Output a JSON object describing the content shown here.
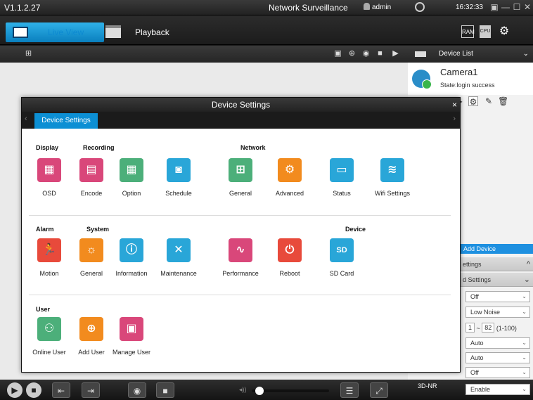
{
  "titlebar": {
    "version": "V1.1.2.27",
    "app_title": "Network Surveillance",
    "user": "admin",
    "time": "16:32:33",
    "globe_icon": "globe-icon",
    "window_buttons": [
      "▣",
      "—",
      "☐",
      "✕"
    ]
  },
  "toolbar": {
    "live_view": "Live View",
    "playback": "Playback",
    "ram_label": "RAM",
    "cpu_label": "CPU",
    "settings_icon": "gear-icon"
  },
  "video_bar": {
    "left_icon": "grid-icon",
    "icons": [
      "▣",
      "⊕",
      "◉",
      "■",
      "▶"
    ]
  },
  "right_panel": {
    "device_list": "Device List",
    "camera_name": "Camera1",
    "camera_state": "State:login success",
    "add_device": "Add Device",
    "settings_section": "ettings",
    "image_settings_section": "d Settings",
    "rows": [
      "Off",
      "Low Noise",
      "Auto",
      "Auto",
      "Off"
    ],
    "range_min": "1",
    "range_max": "82",
    "range_hint": "(1-100)"
  },
  "bottom_bar": {
    "nr_label": "3D-NR",
    "nr_value": "Enable",
    "volume_level": 0.05
  },
  "dialog": {
    "title": "Device Settings",
    "close": "×",
    "tab": "Device Settings",
    "categories": {
      "display": "Display",
      "recording": "Recording",
      "network": "Network",
      "alarm": "Alarm",
      "system": "System",
      "device": "Device",
      "user": "User"
    },
    "row1": [
      {
        "label": "OSD",
        "icon": "osd-icon",
        "glyph": "▦",
        "color": "pink"
      },
      {
        "label": "Encode",
        "icon": "encode-icon",
        "glyph": "▤",
        "color": "pink"
      },
      {
        "label": "Option",
        "icon": "option-icon",
        "glyph": "▦",
        "color": "green"
      },
      {
        "label": "Schedule",
        "icon": "schedule-icon",
        "glyph": "◙",
        "color": "blue"
      },
      {
        "label": "General",
        "icon": "network-general-icon",
        "glyph": "⊞",
        "color": "green"
      },
      {
        "label": "Advanced",
        "icon": "advanced-icon",
        "glyph": "⚙",
        "color": "orange"
      },
      {
        "label": "Status",
        "icon": "status-icon",
        "glyph": "▭",
        "color": "blue"
      },
      {
        "label": "Wifi Settings",
        "icon": "wifi-icon",
        "glyph": "≋",
        "color": "blue"
      }
    ],
    "row2": [
      {
        "label": "Motion",
        "icon": "motion-icon",
        "glyph": "🏃",
        "color": "red"
      },
      {
        "label": "General",
        "icon": "system-general-icon",
        "glyph": "☼",
        "color": "orange"
      },
      {
        "label": "Information",
        "icon": "information-icon",
        "glyph": "ⓘ",
        "color": "blue"
      },
      {
        "label": "Maintenance",
        "icon": "maintenance-icon",
        "glyph": "✕",
        "color": "blue"
      },
      {
        "label": "Performance",
        "icon": "performance-icon",
        "glyph": "∿",
        "color": "pink"
      },
      {
        "label": "Reboot",
        "icon": "reboot-icon",
        "glyph": "⏻",
        "color": "red"
      },
      {
        "label": "SD Card",
        "icon": "sd-card-icon",
        "glyph": "SD",
        "color": "blue"
      }
    ],
    "row3": [
      {
        "label": "Online User",
        "icon": "online-user-icon",
        "glyph": "⚇",
        "color": "green"
      },
      {
        "label": "Add User",
        "icon": "add-user-icon",
        "glyph": "⊕",
        "color": "orange"
      },
      {
        "label": "Manage User",
        "icon": "manage-user-icon",
        "glyph": "▣",
        "color": "pink"
      }
    ]
  },
  "colors": {
    "accent": "#0c8fd4",
    "titlebar": "#2a2a2a"
  }
}
